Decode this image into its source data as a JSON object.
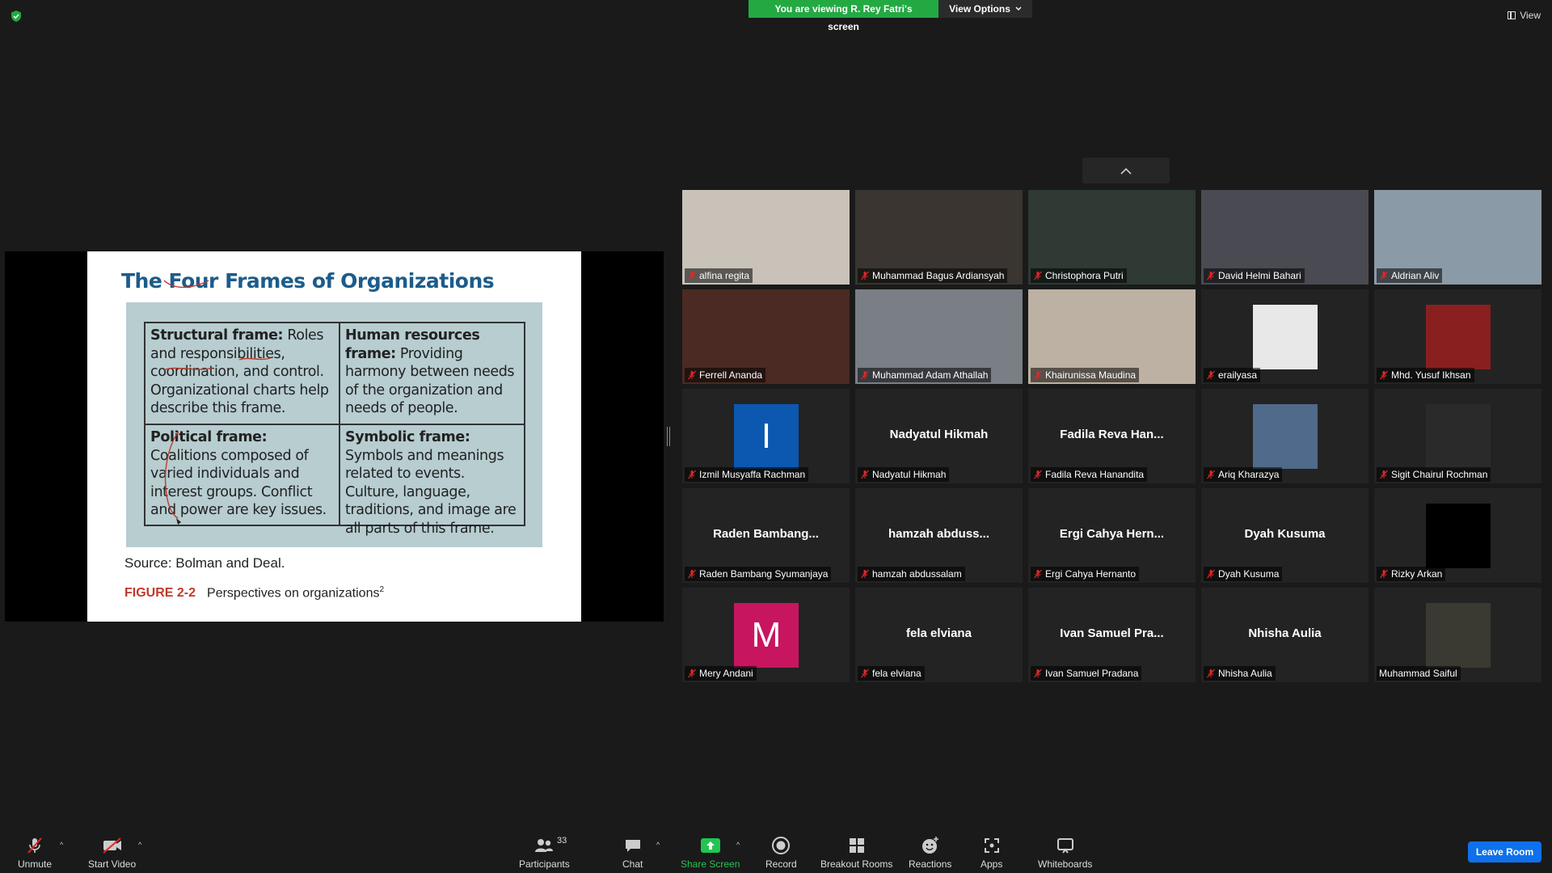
{
  "banner": {
    "viewing_text": "You are viewing R. Rey Fatri's screen",
    "view_options_label": "View Options"
  },
  "top_right": {
    "view_label": "View"
  },
  "slide": {
    "title_prefix": "The ",
    "title_main": "Four Frames of Organizations",
    "cells": [
      {
        "bold": "Structural frame:",
        "text": " Roles and responsibilities, coordination, and control. Organizational charts help describe this frame."
      },
      {
        "bold": "Human resources frame:",
        "text": " Providing harmony between needs of the organization and needs of people."
      },
      {
        "bold": "Political frame:",
        "text": " Coalitions composed of varied individuals and interest groups. Conflict and power are key issues."
      },
      {
        "bold": "Symbolic frame:",
        "text": " Symbols and meanings related to events. Culture, language, traditions, and image are all parts of this frame."
      }
    ],
    "source": "Source: Bolman and Deal.",
    "figure_label": "FIGURE 2-2",
    "figure_caption": "Perspectives on organizations",
    "figure_sup": "2"
  },
  "participants": [
    {
      "name": "alfina regita",
      "display": "video",
      "bg": "#c9c2b8"
    },
    {
      "name": "Muhammad Bagus Ardiansyah",
      "display": "video",
      "bg": "#3a3530"
    },
    {
      "name": "Christophora Putri",
      "display": "video",
      "bg": "#2e3a33"
    },
    {
      "name": "David Helmi Bahari",
      "display": "video",
      "bg": "#4a4a52"
    },
    {
      "name": "Aldrian Aliv",
      "display": "video",
      "bg": "#8a9aa6"
    },
    {
      "name": "Ferrell Ananda",
      "display": "video",
      "bg": "#4a2a22"
    },
    {
      "name": "Muhammad Adam Athallah",
      "display": "video",
      "bg": "#7a7f86"
    },
    {
      "name": "Khairunissa Maudina",
      "display": "video",
      "bg": "#bdb1a3"
    },
    {
      "name": "erailyasa",
      "display": "photo",
      "bg": "#e8e8e8"
    },
    {
      "name": "Mhd. Yusuf Ikhsan",
      "display": "photo",
      "bg": "#8a1f1f"
    },
    {
      "name": "Izmil Musyaffa Rachman",
      "display": "avatar",
      "initial": "I",
      "bg": "#0c57b0"
    },
    {
      "name": "Nadyatul Hikmah",
      "display": "name",
      "big_name": "Nadyatul Hikmah"
    },
    {
      "name": "Fadila Reva Hanandita",
      "display": "name",
      "big_name": "Fadila Reva Han..."
    },
    {
      "name": "Ariq Kharazya",
      "display": "photo",
      "bg": "#4f6a8a"
    },
    {
      "name": "Sigit Chairul Rochman",
      "display": "photo",
      "bg": "#2a2a2a"
    },
    {
      "name": "Raden Bambang Syumanjaya",
      "display": "name",
      "big_name": "Raden  Bambang..."
    },
    {
      "name": "hamzah abdussalam",
      "display": "name",
      "big_name": "hamzah  abduss..."
    },
    {
      "name": "Ergi Cahya Hernanto",
      "display": "name",
      "big_name": "Ergi  Cahya  Hern..."
    },
    {
      "name": "Dyah Kusuma",
      "display": "name",
      "big_name": "Dyah Kusuma"
    },
    {
      "name": "Rizky Arkan",
      "display": "photo",
      "bg": "#000000"
    },
    {
      "name": "Mery Andani",
      "display": "avatar",
      "initial": "M",
      "bg": "#c8155f"
    },
    {
      "name": "fela elviana",
      "display": "name",
      "big_name": "fela elviana"
    },
    {
      "name": "Ivan Samuel Pradana",
      "display": "name",
      "big_name": "Ivan  Samuel  Pra..."
    },
    {
      "name": "Nhisha Aulia",
      "display": "name",
      "big_name": "Nhisha Aulia"
    },
    {
      "name": "Muhammad Saiful",
      "display": "photo",
      "bg": "#3a3a32",
      "unmuted": true
    }
  ],
  "toolbar": {
    "unmute": "Unmute",
    "start_video": "Start Video",
    "participants": "Participants",
    "participants_count": "33",
    "chat": "Chat",
    "share_screen": "Share Screen",
    "record": "Record",
    "breakout_rooms": "Breakout Rooms",
    "reactions": "Reactions",
    "apps": "Apps",
    "whiteboards": "Whiteboards",
    "leave_room": "Leave Room"
  },
  "colors": {
    "accent_green": "#23a942",
    "leave_blue": "#0e71eb",
    "mute_red": "#e02828",
    "slide_title": "#1c5c8a"
  }
}
